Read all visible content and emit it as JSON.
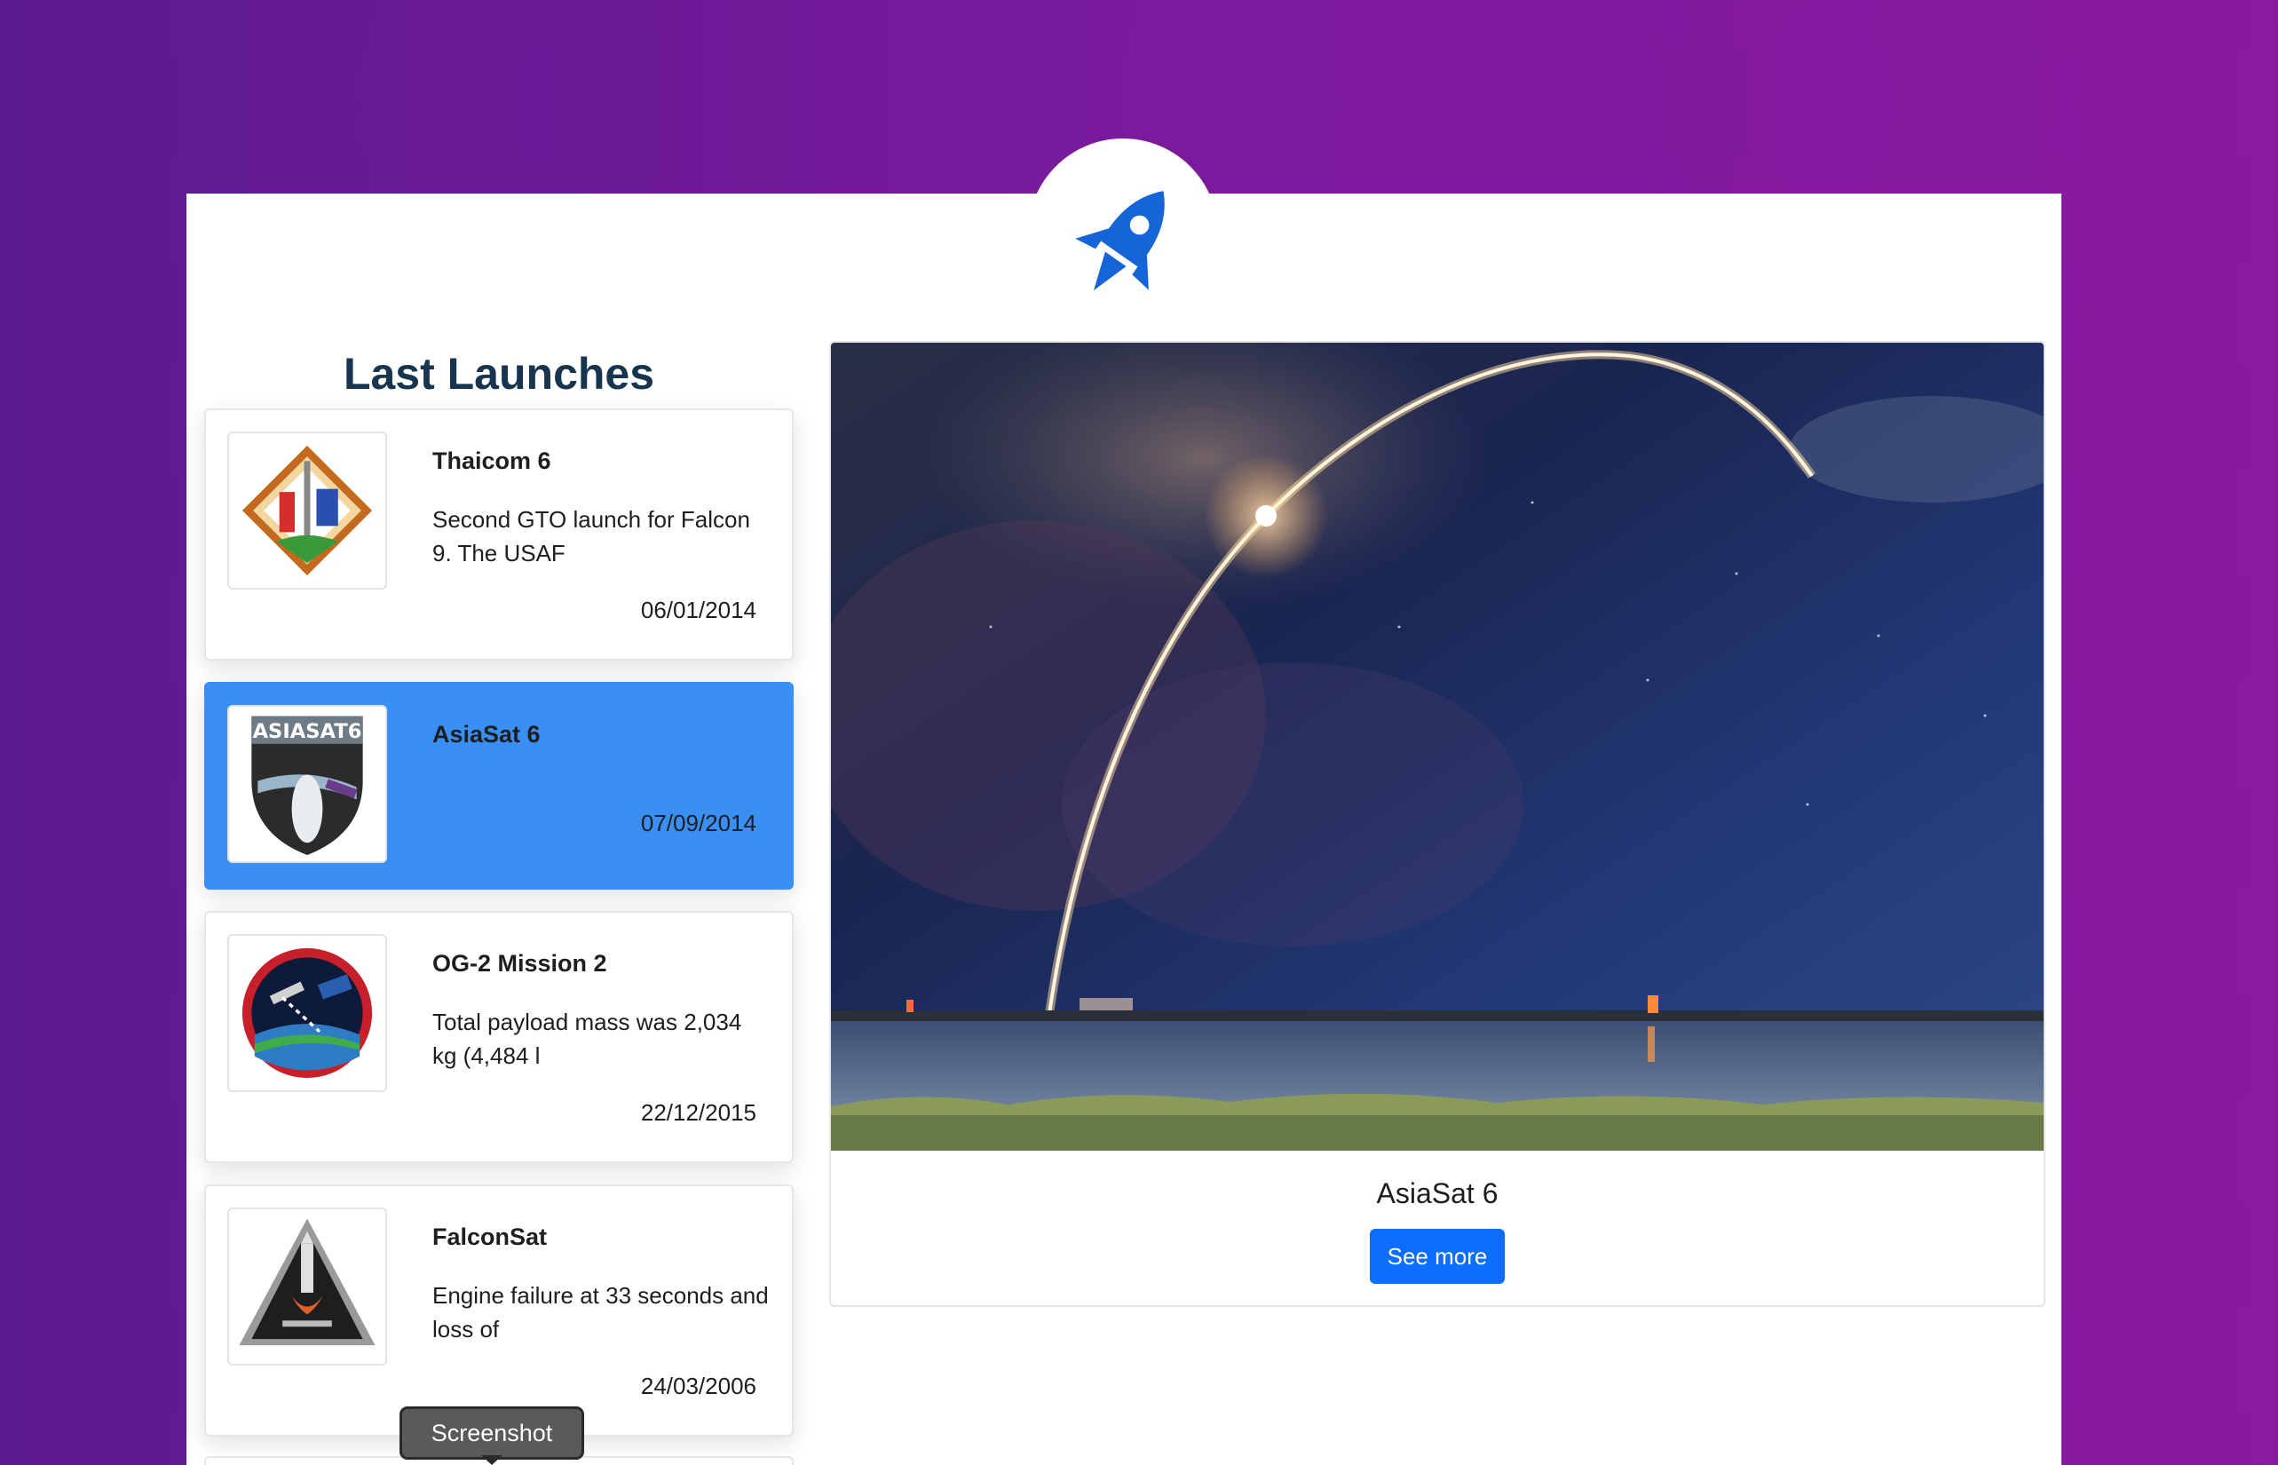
{
  "header": {
    "logo_icon": "rocket-icon",
    "logo_color": "#1565d8"
  },
  "sidebar": {
    "title": "Last Launches",
    "launches": [
      {
        "name": "Thaicom 6",
        "description": "Second GTO launch for Falcon 9. The USAF",
        "date": "06/01/2014",
        "patch_icon": "thaicom-6-mission-patch",
        "selected": false
      },
      {
        "name": "AsiaSat 6",
        "description": "",
        "date": "07/09/2014",
        "patch_icon": "asiasat-6-mission-patch",
        "selected": true
      },
      {
        "name": "OG-2 Mission 2",
        "description": "Total payload mass was 2,034 kg (4,484 l",
        "date": "22/12/2015",
        "patch_icon": "orbcomm-2-mission-patch",
        "selected": false
      },
      {
        "name": "FalconSat",
        "description": "Engine failure at 33 seconds and loss of",
        "date": "24/03/2006",
        "patch_icon": "falconsat-mission-patch",
        "selected": false
      }
    ]
  },
  "detail": {
    "title": "AsiaSat 6",
    "button_label": "See more",
    "photo_icon": "rocket-launch-photo"
  },
  "tooltip": {
    "label": "Screenshot"
  },
  "colors": {
    "accent": "#0d6efd",
    "selected_card": "#3a8ff5",
    "title_text": "#17354e"
  }
}
